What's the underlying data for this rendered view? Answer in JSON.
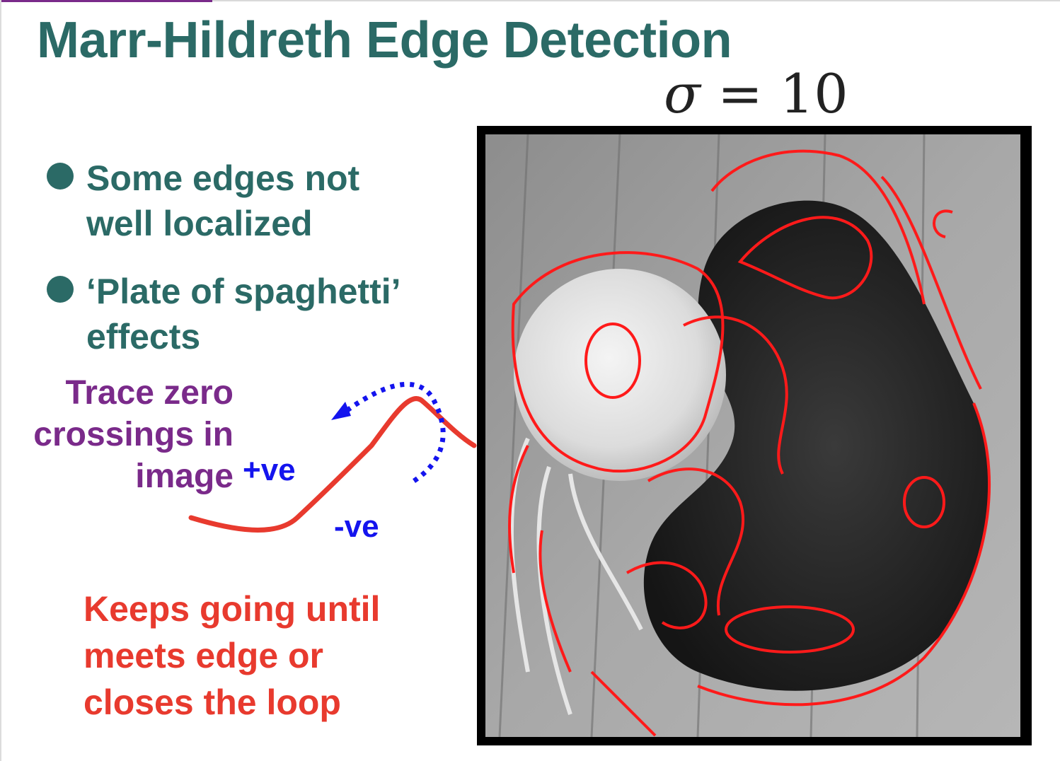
{
  "slide": {
    "title": "Marr-Hildreth Edge Detection",
    "sigma": {
      "symbol": "σ",
      "equals": "=",
      "value": "10"
    },
    "bullets": [
      {
        "lines": [
          "Some edges not",
          "well localized"
        ]
      },
      {
        "lines": [
          "‘Plate of spaghetti’",
          "effects"
        ]
      }
    ],
    "trace_label": [
      "Trace zero",
      "crossings in",
      "image"
    ],
    "positive_label": "+ve",
    "negative_label": "-ve",
    "keeps_label": [
      "Keeps going until",
      "meets edge or",
      "closes the loop"
    ]
  },
  "colors": {
    "title": "#2b6a66",
    "trace_text": "#7a2a8a",
    "sign_labels": "#1414ee",
    "keeps_text": "#e83a2e",
    "zero_crossing_curve": "#e83a2e",
    "trace_arrow": "#1414ee",
    "edge_overlay": "#ff1a1a"
  },
  "icons": {
    "bullet": "bullet-dot-icon",
    "arrow": "dotted-arrow-icon"
  }
}
